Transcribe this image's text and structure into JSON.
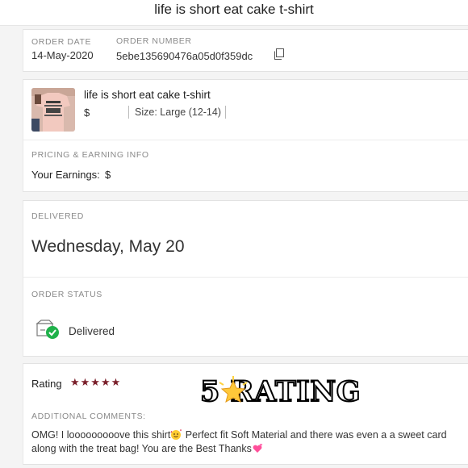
{
  "header": {
    "title": "life is short eat cake t-shirt"
  },
  "order": {
    "date_label": "ORDER DATE",
    "date": "14-May-2020",
    "number_label": "ORDER NUMBER",
    "number": "5ebe135690476a05d0f359dc",
    "copy_icon": "copy-icon"
  },
  "item": {
    "title": "life is short eat cake t-shirt",
    "price": "$",
    "size": "Size: Large (12-14)",
    "thumbnail_icon": "product-thumbnail"
  },
  "pricing": {
    "section_label": "PRICING & EARNING INFO",
    "earnings_label": "Your Earnings:",
    "earnings_value": "$"
  },
  "delivery": {
    "section_label": "DELIVERED",
    "date": "Wednesday, May 20"
  },
  "status": {
    "section_label": "ORDER STATUS",
    "text": "Delivered",
    "icon": "delivered-box-check-icon",
    "check_color": "#1fb14a"
  },
  "rating": {
    "label": "Rating",
    "stars": "★★★★★",
    "star_count": 5,
    "star_color": "#7a1f2a",
    "overlay_text": "5  RATING"
  },
  "comments": {
    "section_label": "ADDITIONAL COMMENTS:",
    "text_part1": "OMG! I looooooooove this shirt",
    "text_part2": " Perfect fit Soft Material and there was even a a sweet card along with the treat bag! You are the Best Thanks"
  }
}
